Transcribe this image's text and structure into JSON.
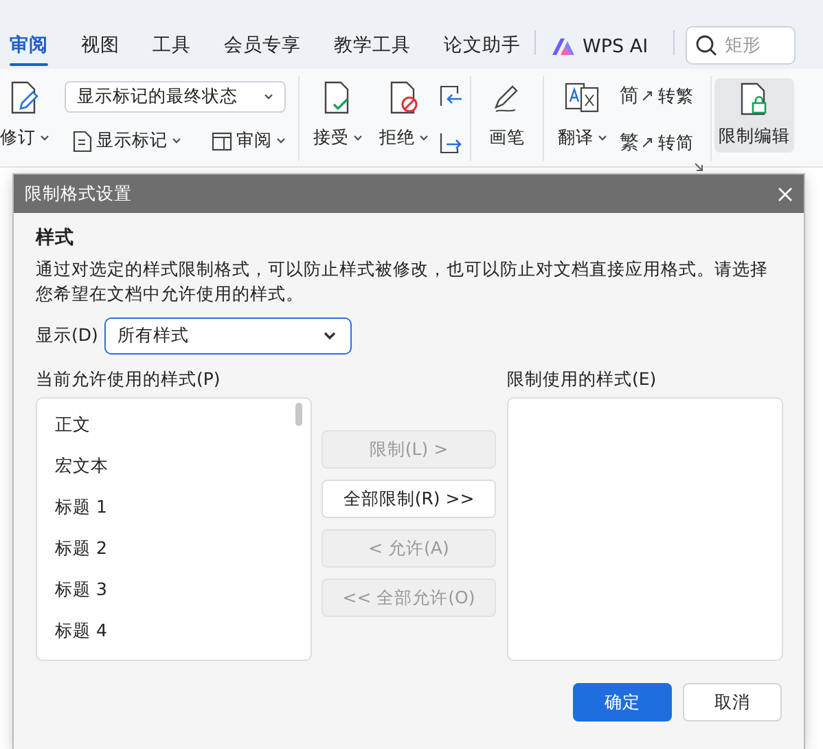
{
  "tabs": [
    {
      "label": "审阅",
      "selected": true
    },
    {
      "label": "视图",
      "selected": false
    },
    {
      "label": "工具",
      "selected": false
    },
    {
      "label": "会员专享",
      "selected": false
    },
    {
      "label": "教学工具",
      "selected": false
    },
    {
      "label": "论文助手",
      "selected": false
    }
  ],
  "ai_tab": {
    "label": "WPS AI"
  },
  "search": {
    "placeholder": "矩形"
  },
  "ribbon": {
    "track_changes": {
      "label": "修订"
    },
    "markup_select": {
      "value": "显示标记的最终状态"
    },
    "show_markup": {
      "label": "显示标记"
    },
    "review_pane": {
      "label": "审阅"
    },
    "accept": {
      "label": "接受"
    },
    "reject": {
      "label": "拒绝"
    },
    "pen": {
      "label": "画笔"
    },
    "translate": {
      "label": "翻译"
    },
    "to_traditional": {
      "glyph": "简",
      "label": "转繁"
    },
    "to_simplified": {
      "glyph": "繁",
      "label": "转简"
    },
    "restrict_editing": {
      "label": "限制编辑",
      "selected": true
    }
  },
  "dialog": {
    "title": "限制格式设置",
    "heading": "样式",
    "description": "通过对选定的样式限制格式，可以防止样式被修改，也可以防止对文档直接应用格式。请选择您希望在文档中允许使用的样式。",
    "display_label": "显示(D)",
    "display_value": "所有样式",
    "allowed_label": "当前允许使用的样式(P)",
    "allowed_styles": [
      {
        "label": "正文",
        "selected": false
      },
      {
        "label": "宏文本",
        "selected": false
      },
      {
        "label": "标题 1",
        "selected": false
      },
      {
        "label": "标题 2",
        "selected": false
      },
      {
        "label": "标题 3",
        "selected": false
      },
      {
        "label": "标题 4",
        "selected": false
      }
    ],
    "move_buttons": [
      {
        "label": "限制(L) >",
        "disabled": true
      },
      {
        "label": "全部限制(R) >>",
        "disabled": false
      },
      {
        "label": "< 允许(A)",
        "disabled": true
      },
      {
        "label": "<< 全部允许(O)",
        "disabled": true
      }
    ],
    "restricted_label": "限制使用的样式(E)",
    "ok": "确定",
    "cancel": "取消"
  }
}
